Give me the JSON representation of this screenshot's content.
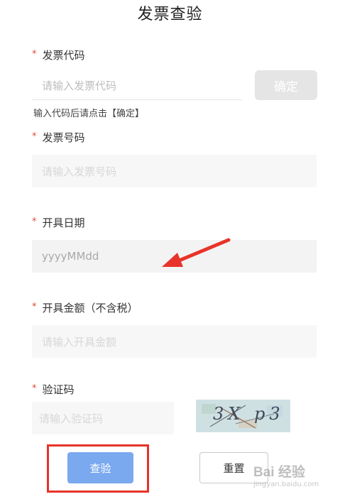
{
  "page": {
    "title": "发票查验"
  },
  "form": {
    "invoice_code": {
      "required_mark": "*",
      "label": "发票代码",
      "placeholder": "请输入发票代码",
      "confirm_label": "确定",
      "hint": "输入代码后请点击【确定】"
    },
    "invoice_number": {
      "required_mark": "*",
      "label": "发票号码",
      "placeholder": "请输入发票号码"
    },
    "issue_date": {
      "required_mark": "*",
      "label": "开具日期",
      "placeholder": "yyyyMMdd"
    },
    "amount": {
      "required_mark": "*",
      "label": "开具金额（不含税）",
      "placeholder": "请输入开具金额"
    },
    "captcha": {
      "required_mark": "*",
      "label": "验证码",
      "placeholder": "请输入验证码",
      "image_text": "3X p3"
    }
  },
  "actions": {
    "query_label": "查验",
    "reset_label": "重置"
  },
  "annotations": {
    "arrow_color": "#e8332a",
    "highlight_color": "#e8332a"
  },
  "watermark": {
    "text": "Bai 经验",
    "sub": "jingyan.baidu.com"
  }
}
